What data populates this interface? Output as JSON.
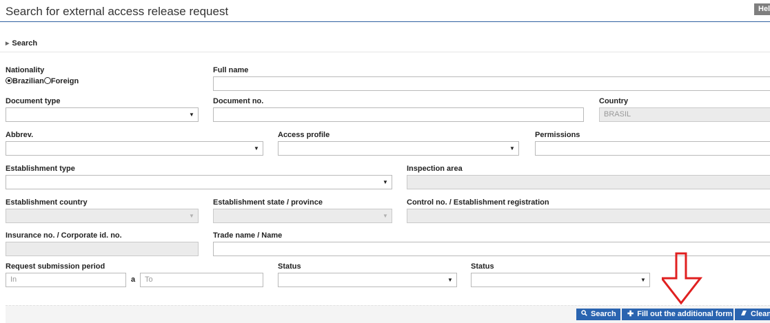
{
  "header": {
    "title": "Search for external access release request",
    "help_label": "Help"
  },
  "section": {
    "label": "Search"
  },
  "nationality": {
    "label": "Nationality",
    "options": [
      "Brazilian",
      "Foreign"
    ],
    "selected": "Brazilian"
  },
  "full_name": {
    "label": "Full name",
    "value": ""
  },
  "document_type": {
    "label": "Document type",
    "value": ""
  },
  "document_no": {
    "label": "Document no.",
    "value": ""
  },
  "country": {
    "label": "Country",
    "value": "BRASIL"
  },
  "abbrev": {
    "label": "Abbrev.",
    "value": ""
  },
  "access_profile": {
    "label": "Access profile",
    "value": ""
  },
  "permissions": {
    "label": "Permissions",
    "value": ""
  },
  "establishment_type": {
    "label": "Establishment type",
    "value": ""
  },
  "inspection_area": {
    "label": "Inspection area",
    "value": ""
  },
  "establishment_country": {
    "label": "Establishment country",
    "value": ""
  },
  "establishment_state": {
    "label": "Establishment state / province",
    "value": ""
  },
  "control_no": {
    "label": "Control no. / Establishment registration",
    "value": ""
  },
  "insurance_no": {
    "label": "Insurance no. / Corporate id. no.",
    "value": ""
  },
  "trade_name": {
    "label": "Trade name / Name",
    "value": ""
  },
  "request_period": {
    "label": "Request submission period",
    "from_placeholder": "In",
    "separator": "a",
    "to_placeholder": "To"
  },
  "status_1": {
    "label": "Status",
    "value": ""
  },
  "status_2": {
    "label": "Status",
    "value": ""
  },
  "actions": {
    "search_label": "Search",
    "fill_form_label": "Fill out the additional form",
    "clean_label": "Clean"
  },
  "colors": {
    "accent": "#2a64b0",
    "annotation_arrow": "#e02020",
    "title_rule": "#2e5fa0"
  },
  "icons": {
    "search": "magnifier-icon",
    "add": "plus-icon",
    "clean": "eraser-icon",
    "select": "caret-down-icon"
  }
}
